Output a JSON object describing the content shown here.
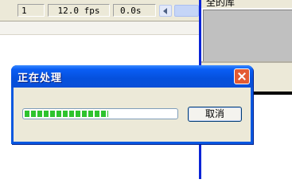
{
  "timeline": {
    "frame": "1",
    "fps": "12.0 fps",
    "time": "0.0s"
  },
  "library": {
    "title": "全的库"
  },
  "dialog": {
    "title": "正在处理",
    "progress": 0.55,
    "cancel_label": "取消"
  },
  "colors": {
    "title_bar": "#0a58e0",
    "progress_fill": "#2ec32e",
    "close_button": "#e35b32",
    "panel_divider": "#0a24d6"
  },
  "icons": {
    "close": "close-icon",
    "scroll_left": "scroll-left-arrow-icon"
  }
}
